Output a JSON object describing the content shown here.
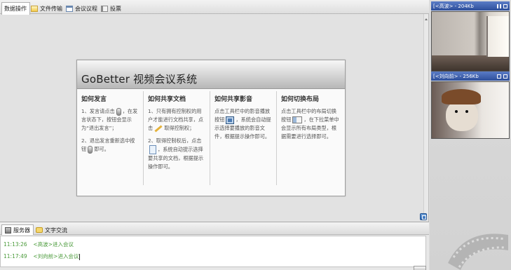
{
  "main_tabs": [
    {
      "label": "数据操作",
      "icon": "none",
      "active": true
    },
    {
      "label": "文件传输",
      "icon": "folder-icon",
      "active": false
    },
    {
      "label": "会议议程",
      "icon": "agenda-icon",
      "active": false
    },
    {
      "label": "投票",
      "icon": "vote-icon",
      "active": false
    }
  ],
  "welcome": {
    "title": "GoBetter 视频会议系统",
    "columns": [
      {
        "heading": "如何发言",
        "p1": "1、发言请点击",
        "p1b": "，在发言状态下，按钮会显示为“退出发言”；",
        "p2": "2、退出发言重新选中按钮",
        "p2b": "即可。"
      },
      {
        "heading": "如何共享文档",
        "p1": "1、只有拥有控制权的用户才能进行文档共享，点击",
        "p1b": "取得控制权；",
        "p2": "2、取得控制权后，点击",
        "p2b": "，系统自动提示选择要共享的文档，根据提示操作即可。"
      },
      {
        "heading": "如何共享影音",
        "p1": "点击工具栏中的影音播放按钮",
        "p1b": "，系统会自动提示选择要播放的影音文件，根据提示操作即可。"
      },
      {
        "heading": "如何切换布局",
        "p1": "点击工具栏中的布局切换按钮",
        "p1b": "，在下拉菜单中会显示所有布局类型，根据需要进行选择即可。"
      }
    ]
  },
  "log_tabs": [
    {
      "label": "服务器",
      "active": true
    },
    {
      "label": "文字交流",
      "active": false
    }
  ],
  "log_entries": [
    {
      "time": "11:13:26",
      "text": "<高波>进入会议"
    },
    {
      "time": "11:17:49",
      "text": "<刘向前>进入会议"
    }
  ],
  "videos": [
    {
      "label": "[<高波> - 204Kb",
      "controls": [
        "pause-icon",
        "restore-icon"
      ]
    },
    {
      "label": "[<刘向前> - 256Kb",
      "controls": [
        "restore-icon",
        "restore-icon"
      ]
    }
  ],
  "colors": {
    "video_bar": "#3a5ea8",
    "log_text": "#4a9a3a"
  }
}
